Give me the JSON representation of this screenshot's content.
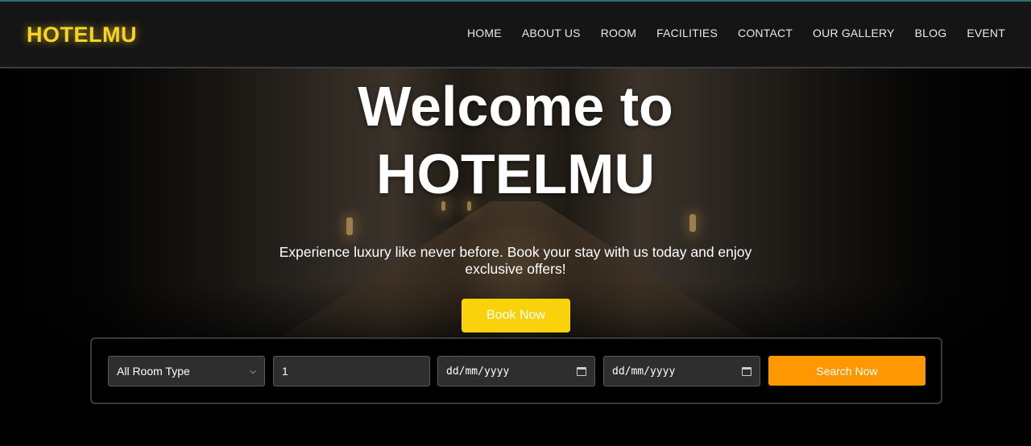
{
  "header": {
    "logo": "HOTELMU",
    "nav": [
      "HOME",
      "ABOUT US",
      "ROOM",
      "FACILITIES",
      "CONTACT",
      "OUR GALLERY",
      "BLOG",
      "EVENT"
    ]
  },
  "hero": {
    "title_line1": "Welcome to",
    "title_line2": "HOTELMU",
    "subtitle": "Experience luxury like never before. Book your stay with us today and enjoy exclusive offers!",
    "book_button": "Book Now"
  },
  "search": {
    "room_type": "All Room Type",
    "guests": "1",
    "check_in": "dd/mm/yyyy",
    "check_out": "dd/mm/yyyy",
    "button": "Search Now"
  },
  "colors": {
    "logo": "#f9d423",
    "book_button": "#f9d20b",
    "search_button": "#ff9800"
  }
}
